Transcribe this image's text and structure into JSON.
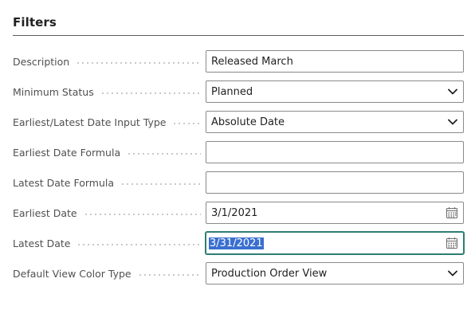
{
  "section": {
    "title": "Filters"
  },
  "fields": [
    {
      "label": "Description",
      "value": "Released March",
      "kind": "text"
    },
    {
      "label": "Minimum Status",
      "value": "Planned",
      "kind": "select"
    },
    {
      "label": "Earliest/Latest Date Input Type",
      "value": "Absolute Date",
      "kind": "select"
    },
    {
      "label": "Earliest Date Formula",
      "value": "",
      "kind": "text"
    },
    {
      "label": "Latest Date Formula",
      "value": "",
      "kind": "text"
    },
    {
      "label": "Earliest Date",
      "value": "3/1/2021",
      "kind": "date"
    },
    {
      "label": "Latest Date",
      "value": "3/31/2021",
      "kind": "date",
      "state": "focused, text selected"
    },
    {
      "label": "Default View Color Type",
      "value": "Production Order View",
      "kind": "select"
    }
  ],
  "colors": {
    "focus_border": "#2e7d73",
    "selection_bg": "#3a6fd0",
    "label_text": "#505050",
    "field_border": "#8a8a8a"
  },
  "icons": {
    "select": "chevron-down-icon",
    "date": "calendar-icon"
  }
}
